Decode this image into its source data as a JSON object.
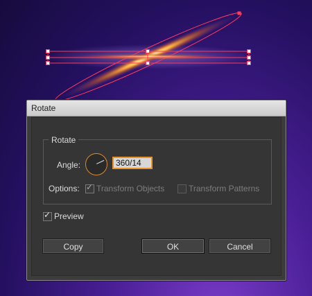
{
  "dialog": {
    "title": "Rotate",
    "group_title": "Rotate",
    "angle_label": "Angle:",
    "angle_value": "360/14",
    "options_label": "Options:",
    "transform_objects_label": "Transform Objects",
    "transform_objects_checked": true,
    "transform_patterns_label": "Transform Patterns",
    "transform_patterns_checked": false,
    "preview_label": "Preview",
    "preview_checked": true,
    "copy_button": "Copy",
    "ok_button": "OK",
    "cancel_button": "Cancel"
  },
  "colors": {
    "selection": "#ff3a5a",
    "accent": "#e8912d",
    "glow": "#ffb347"
  }
}
